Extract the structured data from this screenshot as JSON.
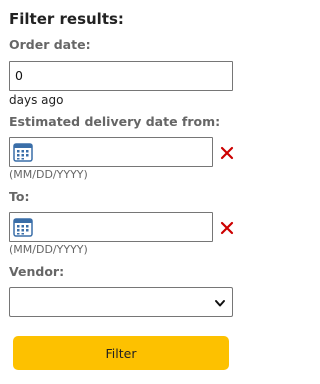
{
  "title": "Filter results:",
  "order_date": {
    "label": "Order date:",
    "value": "0",
    "suffix": "days ago"
  },
  "delivery_from": {
    "label": "Estimated delivery date from:",
    "hint": "(MM/DD/YYYY)",
    "value": "",
    "icon": "calendar-icon",
    "clear_icon": "close-icon"
  },
  "delivery_to": {
    "label": "To:",
    "hint": "(MM/DD/YYYY)",
    "value": "",
    "icon": "calendar-icon",
    "clear_icon": "close-icon"
  },
  "vendor": {
    "label": "Vendor:",
    "selected": ""
  },
  "filter_button": {
    "label": "Filter"
  },
  "colors": {
    "accent": "#fdc100",
    "clear_red": "#cc0000",
    "calendar_blue": "#3a6ea8"
  }
}
